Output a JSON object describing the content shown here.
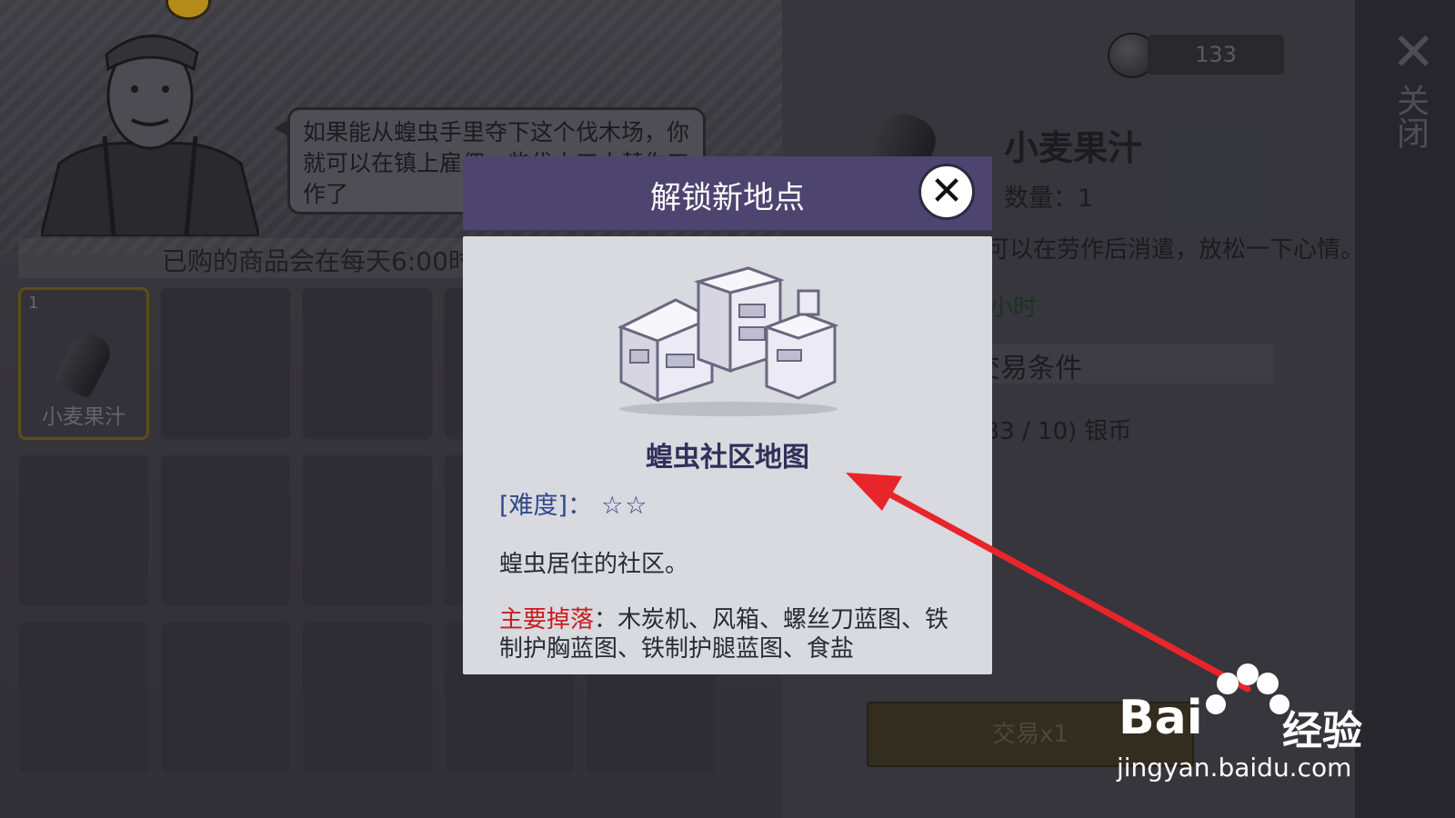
{
  "merchant": {
    "dialogue": "如果能从蝗虫手里夺下这个伐木场，你就可以在镇上雇佣一些伐木工人替你工作了"
  },
  "shop": {
    "refresh_notice": "已购的商品会在每天6:00时刷新",
    "items": [
      {
        "count": "1",
        "name": "小麦果汁",
        "selected": true
      }
    ]
  },
  "currency": {
    "amount": "133",
    "icon": "silver-coin-icon"
  },
  "item_detail": {
    "title": "小麦果汁",
    "quantity": "数量：1",
    "description": "可以在劳作后消遣，放松一下心情。",
    "duration": "小时",
    "trade_conditions_label": "交易条件",
    "requirement": "(133 / 10) 银币",
    "trade_button": "交易x1"
  },
  "side_close": {
    "label": "关闭",
    "icon": "close-icon"
  },
  "dialog": {
    "title": "解锁新地点",
    "close_icon": "close-icon",
    "map_name": "蝗虫社区地图",
    "difficulty_label": "[难度]：",
    "difficulty_stars": "☆☆",
    "description": "蝗虫居住的社区。",
    "drops_label": "主要掉落",
    "drops_text": "：木炭机、风箱、螺丝刀蓝图、铁制护胸蓝图、铁制护腿蓝图、食盐"
  },
  "watermark": {
    "brand": "Bai",
    "brand_cn": "经验",
    "url": "jingyan.baidu.com"
  },
  "colors": {
    "dialog_header": "#4d4470",
    "dialog_body": "#d9d9e0",
    "drops_label": "#cc1c1c",
    "difficulty": "#2f4a8a",
    "arrow": "#e8252a"
  }
}
